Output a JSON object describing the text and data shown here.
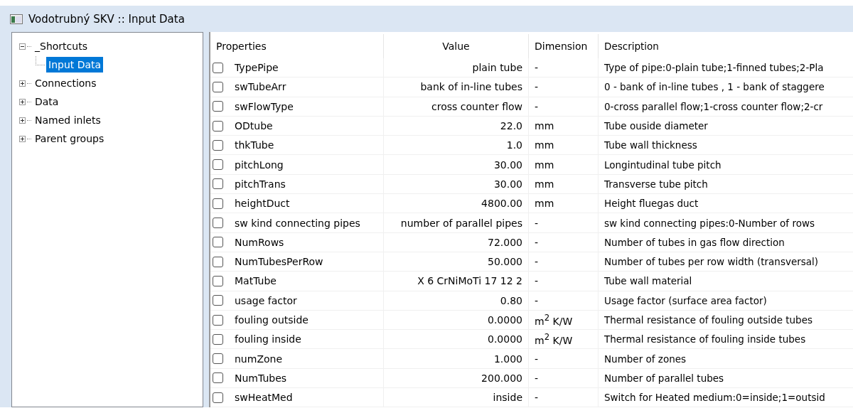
{
  "window": {
    "title": "Vodotrubný SKV :: Input Data"
  },
  "tree": [
    {
      "label": "_Shortcuts",
      "expanded": true,
      "selected": false,
      "children": [
        {
          "label": "Input Data",
          "selected": true
        }
      ]
    },
    {
      "label": "Connections",
      "expanded": false,
      "selected": false
    },
    {
      "label": "Data",
      "expanded": false,
      "selected": false
    },
    {
      "label": "Named inlets",
      "expanded": false,
      "selected": false
    },
    {
      "label": "Parent groups",
      "expanded": false,
      "selected": false
    }
  ],
  "table": {
    "columns": [
      "Properties",
      "Value",
      "Dimension",
      "Description"
    ],
    "rows": [
      {
        "checked": false,
        "property": "TypePipe",
        "value": "plain tube",
        "dimension": "-",
        "description": "Type of pipe:0-plain tube;1-finned tubes;2-Pla"
      },
      {
        "checked": false,
        "property": "swTubeArr",
        "value": "bank of in-line tubes",
        "dimension": "-",
        "description": "0 - bank of in-line tubes , 1 - bank of staggere"
      },
      {
        "checked": false,
        "property": "swFlowType",
        "value": "cross counter flow",
        "dimension": "-",
        "description": "0-cross parallel flow;1-cross counter flow;2-cr"
      },
      {
        "checked": false,
        "property": "ODtube",
        "value": "22.0",
        "dimension": "mm",
        "description": "Tube ouside diameter"
      },
      {
        "checked": false,
        "property": "thkTube",
        "value": "1.0",
        "dimension": "mm",
        "description": "Tube wall thickness"
      },
      {
        "checked": false,
        "property": "pitchLong",
        "value": "30.00",
        "dimension": "mm",
        "description": "Longintudinal tube pitch"
      },
      {
        "checked": false,
        "property": "pitchTrans",
        "value": "30.00",
        "dimension": "mm",
        "description": "Transverse tube pitch"
      },
      {
        "checked": false,
        "property": "heightDuct",
        "value": "4800.00",
        "dimension": "mm",
        "description": "Height fluegas duct"
      },
      {
        "checked": false,
        "property": "sw kind connecting pipes",
        "value": "number of parallel pipes",
        "dimension": "-",
        "description": "sw kind connecting pipes:0-Number of rows"
      },
      {
        "checked": false,
        "property": "NumRows",
        "value": "72.000",
        "dimension": "-",
        "description": "Number of tubes in gas flow direction"
      },
      {
        "checked": false,
        "property": "NumTubesPerRow",
        "value": "50.000",
        "dimension": "-",
        "description": "Number of tubes per row width (transversal)"
      },
      {
        "checked": false,
        "property": "MatTube",
        "value": "X 6 CrNiMoTi 17 12 2",
        "dimension": "-",
        "description": "Tube wall material"
      },
      {
        "checked": false,
        "property": "usage factor",
        "value": "0.80",
        "dimension": "-",
        "description": "Usage factor (surface area factor)"
      },
      {
        "checked": false,
        "property": "fouling outside",
        "value": "0.0000",
        "dimension": "m$^{2}$ K/W",
        "description": "Thermal resistance of fouling outside tubes"
      },
      {
        "checked": false,
        "property": "fouling inside",
        "value": "0.0000",
        "dimension": "m$^{2}$ K/W",
        "description": "Thermal resistance of fouling inside tubes"
      },
      {
        "checked": false,
        "property": "numZone",
        "value": "1.000",
        "dimension": "-",
        "description": "Number of zones"
      },
      {
        "checked": false,
        "property": "NumTubes",
        "value": "200.000",
        "dimension": "-",
        "description": "Number of parallel tubes"
      },
      {
        "checked": false,
        "property": "swHeatMed",
        "value": "inside",
        "dimension": "-",
        "description": "Switch for Heated medium:0=inside;1=outsid"
      }
    ]
  }
}
